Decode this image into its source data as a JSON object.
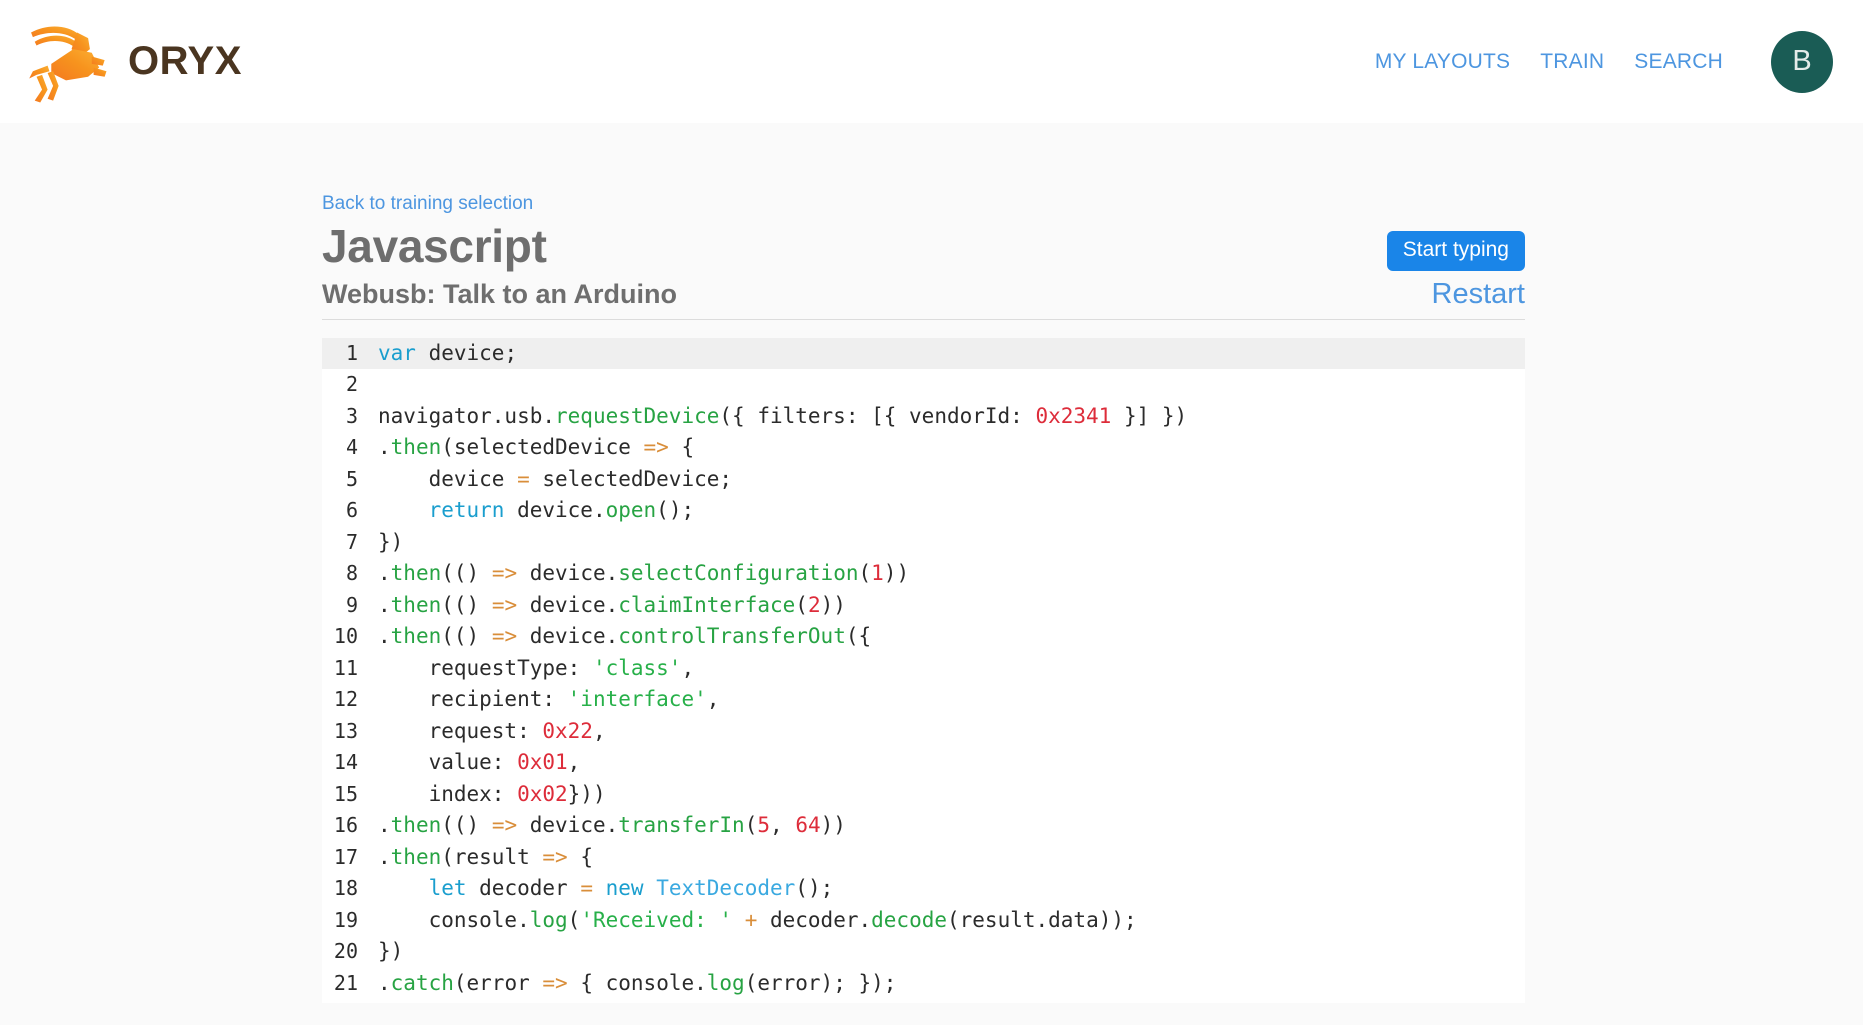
{
  "brand": {
    "name": "ORYX",
    "logo_icon": "oryx-antelope-logo"
  },
  "nav": {
    "links": [
      {
        "label": "MY LAYOUTS"
      },
      {
        "label": "TRAIN"
      },
      {
        "label": "SEARCH"
      }
    ],
    "avatar_initial": "B"
  },
  "page": {
    "back_link": "Back to training selection",
    "title": "Javascript",
    "subtitle": "Webusb: Talk to an Arduino",
    "start_button": "Start typing",
    "restart_link": "Restart"
  },
  "colors": {
    "accent_blue": "#1a85e8",
    "link_blue": "#4d96e0",
    "avatar_teal": "#1a5c55",
    "brand_orange": "#f7941e",
    "brand_text": "#4a3520",
    "active_line": "#efefef",
    "token_keyword": "#1a9ece",
    "token_function": "#27a343",
    "token_string": "#27b049",
    "token_number": "#dd2c3a",
    "token_operator": "#d98e3a",
    "token_class": "#3aa9e0"
  },
  "editor": {
    "active_line_number": 1,
    "total_lines": 21,
    "lines": [
      {
        "n": "1",
        "tokens": [
          {
            "t": "var",
            "c": "t-kw"
          },
          {
            "t": " device;",
            "c": "t-pl"
          }
        ]
      },
      {
        "n": "2",
        "tokens": [
          {
            "t": "",
            "c": "t-pl"
          }
        ]
      },
      {
        "n": "3",
        "tokens": [
          {
            "t": "navigator.usb.",
            "c": "t-pl"
          },
          {
            "t": "requestDevice",
            "c": "t-fn"
          },
          {
            "t": "({ filters: [{ vendorId: ",
            "c": "t-pl"
          },
          {
            "t": "0x2341",
            "c": "t-num"
          },
          {
            "t": " }] })",
            "c": "t-pl"
          }
        ]
      },
      {
        "n": "4",
        "tokens": [
          {
            "t": ".",
            "c": "t-pl"
          },
          {
            "t": "then",
            "c": "t-fn"
          },
          {
            "t": "(selectedDevice ",
            "c": "t-pl"
          },
          {
            "t": "=>",
            "c": "t-op"
          },
          {
            "t": " {",
            "c": "t-pl"
          }
        ]
      },
      {
        "n": "5",
        "tokens": [
          {
            "t": "    device ",
            "c": "t-pl"
          },
          {
            "t": "=",
            "c": "t-op"
          },
          {
            "t": " selectedDevice;",
            "c": "t-pl"
          }
        ]
      },
      {
        "n": "6",
        "tokens": [
          {
            "t": "    ",
            "c": "t-pl"
          },
          {
            "t": "return",
            "c": "t-kw"
          },
          {
            "t": " device.",
            "c": "t-pl"
          },
          {
            "t": "open",
            "c": "t-fn"
          },
          {
            "t": "();",
            "c": "t-pl"
          }
        ]
      },
      {
        "n": "7",
        "tokens": [
          {
            "t": "})",
            "c": "t-pl"
          }
        ]
      },
      {
        "n": "8",
        "tokens": [
          {
            "t": ".",
            "c": "t-pl"
          },
          {
            "t": "then",
            "c": "t-fn"
          },
          {
            "t": "(() ",
            "c": "t-pl"
          },
          {
            "t": "=>",
            "c": "t-op"
          },
          {
            "t": " device.",
            "c": "t-pl"
          },
          {
            "t": "selectConfiguration",
            "c": "t-fn"
          },
          {
            "t": "(",
            "c": "t-pl"
          },
          {
            "t": "1",
            "c": "t-num"
          },
          {
            "t": "))",
            "c": "t-pl"
          }
        ]
      },
      {
        "n": "9",
        "tokens": [
          {
            "t": ".",
            "c": "t-pl"
          },
          {
            "t": "then",
            "c": "t-fn"
          },
          {
            "t": "(() ",
            "c": "t-pl"
          },
          {
            "t": "=>",
            "c": "t-op"
          },
          {
            "t": " device.",
            "c": "t-pl"
          },
          {
            "t": "claimInterface",
            "c": "t-fn"
          },
          {
            "t": "(",
            "c": "t-pl"
          },
          {
            "t": "2",
            "c": "t-num"
          },
          {
            "t": "))",
            "c": "t-pl"
          }
        ]
      },
      {
        "n": "10",
        "tokens": [
          {
            "t": ".",
            "c": "t-pl"
          },
          {
            "t": "then",
            "c": "t-fn"
          },
          {
            "t": "(() ",
            "c": "t-pl"
          },
          {
            "t": "=>",
            "c": "t-op"
          },
          {
            "t": " device.",
            "c": "t-pl"
          },
          {
            "t": "controlTransferOut",
            "c": "t-fn"
          },
          {
            "t": "({",
            "c": "t-pl"
          }
        ]
      },
      {
        "n": "11",
        "tokens": [
          {
            "t": "    requestType: ",
            "c": "t-pl"
          },
          {
            "t": "'class'",
            "c": "t-str"
          },
          {
            "t": ",",
            "c": "t-pl"
          }
        ]
      },
      {
        "n": "12",
        "tokens": [
          {
            "t": "    recipient: ",
            "c": "t-pl"
          },
          {
            "t": "'interface'",
            "c": "t-str"
          },
          {
            "t": ",",
            "c": "t-pl"
          }
        ]
      },
      {
        "n": "13",
        "tokens": [
          {
            "t": "    request: ",
            "c": "t-pl"
          },
          {
            "t": "0x22",
            "c": "t-num"
          },
          {
            "t": ",",
            "c": "t-pl"
          }
        ]
      },
      {
        "n": "14",
        "tokens": [
          {
            "t": "    value: ",
            "c": "t-pl"
          },
          {
            "t": "0x01",
            "c": "t-num"
          },
          {
            "t": ",",
            "c": "t-pl"
          }
        ]
      },
      {
        "n": "15",
        "tokens": [
          {
            "t": "    index: ",
            "c": "t-pl"
          },
          {
            "t": "0x02",
            "c": "t-num"
          },
          {
            "t": "}))",
            "c": "t-pl"
          }
        ]
      },
      {
        "n": "16",
        "tokens": [
          {
            "t": ".",
            "c": "t-pl"
          },
          {
            "t": "then",
            "c": "t-fn"
          },
          {
            "t": "(() ",
            "c": "t-pl"
          },
          {
            "t": "=>",
            "c": "t-op"
          },
          {
            "t": " device.",
            "c": "t-pl"
          },
          {
            "t": "transferIn",
            "c": "t-fn"
          },
          {
            "t": "(",
            "c": "t-pl"
          },
          {
            "t": "5",
            "c": "t-num"
          },
          {
            "t": ", ",
            "c": "t-pl"
          },
          {
            "t": "64",
            "c": "t-num"
          },
          {
            "t": "))",
            "c": "t-pl"
          }
        ]
      },
      {
        "n": "17",
        "tokens": [
          {
            "t": ".",
            "c": "t-pl"
          },
          {
            "t": "then",
            "c": "t-fn"
          },
          {
            "t": "(result ",
            "c": "t-pl"
          },
          {
            "t": "=>",
            "c": "t-op"
          },
          {
            "t": " {",
            "c": "t-pl"
          }
        ]
      },
      {
        "n": "18",
        "tokens": [
          {
            "t": "    ",
            "c": "t-pl"
          },
          {
            "t": "let",
            "c": "t-kw"
          },
          {
            "t": " decoder ",
            "c": "t-pl"
          },
          {
            "t": "=",
            "c": "t-op"
          },
          {
            "t": " ",
            "c": "t-pl"
          },
          {
            "t": "new",
            "c": "t-kw"
          },
          {
            "t": " ",
            "c": "t-pl"
          },
          {
            "t": "TextDecoder",
            "c": "t-cls"
          },
          {
            "t": "();",
            "c": "t-pl"
          }
        ]
      },
      {
        "n": "19",
        "tokens": [
          {
            "t": "    console.",
            "c": "t-pl"
          },
          {
            "t": "log",
            "c": "t-fn"
          },
          {
            "t": "(",
            "c": "t-pl"
          },
          {
            "t": "'Received: '",
            "c": "t-str"
          },
          {
            "t": " ",
            "c": "t-pl"
          },
          {
            "t": "+",
            "c": "t-op"
          },
          {
            "t": " decoder.",
            "c": "t-pl"
          },
          {
            "t": "decode",
            "c": "t-fn"
          },
          {
            "t": "(result.data));",
            "c": "t-pl"
          }
        ]
      },
      {
        "n": "20",
        "tokens": [
          {
            "t": "})",
            "c": "t-pl"
          }
        ]
      },
      {
        "n": "21",
        "tokens": [
          {
            "t": ".",
            "c": "t-pl"
          },
          {
            "t": "catch",
            "c": "t-fn"
          },
          {
            "t": "(error ",
            "c": "t-pl"
          },
          {
            "t": "=>",
            "c": "t-op"
          },
          {
            "t": " { console.",
            "c": "t-pl"
          },
          {
            "t": "log",
            "c": "t-fn"
          },
          {
            "t": "(error); });",
            "c": "t-pl"
          }
        ]
      }
    ]
  }
}
